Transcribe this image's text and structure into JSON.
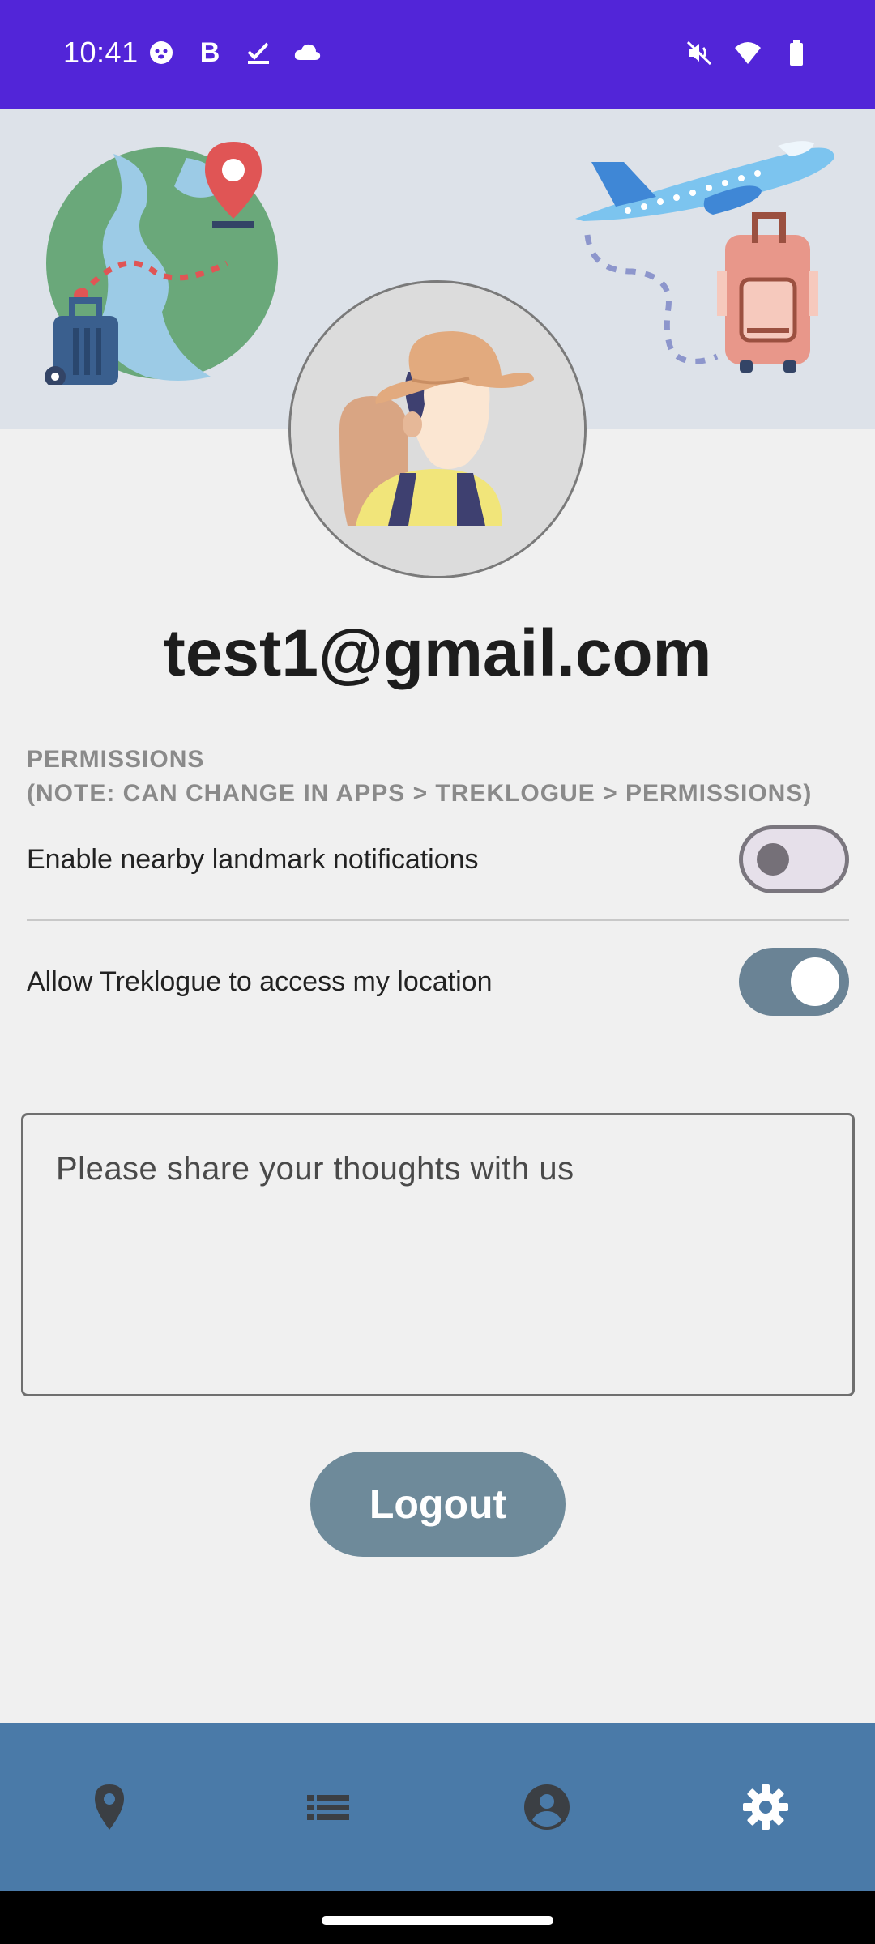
{
  "status_bar": {
    "time": "10:41",
    "left_icons": [
      "otter-icon",
      "bold-b-icon",
      "task-check-icon",
      "cloud-icon"
    ],
    "bold_letter": "B",
    "right_icons": [
      "mute-icon",
      "wifi-icon",
      "battery-icon"
    ],
    "background": "#5225d8"
  },
  "profile": {
    "email": "test1@gmail.com"
  },
  "permissions": {
    "title": "PERMISSIONS",
    "note": "(NOTE: CAN CHANGE IN APPS > TREKLOGUE > PERMISSIONS)",
    "items": [
      {
        "label": "Enable nearby landmark notifications",
        "enabled": false
      },
      {
        "label": "Allow Treklogue to access my location",
        "enabled": true
      }
    ]
  },
  "feedback": {
    "placeholder": "Please share your thoughts with us",
    "value": ""
  },
  "logout_label": "Logout",
  "bottom_nav": {
    "items": [
      {
        "name": "map",
        "icon": "location-pin-icon",
        "active": false
      },
      {
        "name": "list",
        "icon": "list-icon",
        "active": false
      },
      {
        "name": "profile",
        "icon": "account-circle-icon",
        "active": false
      },
      {
        "name": "settings",
        "icon": "gear-icon",
        "active": true
      }
    ],
    "background": "#4a7aa8"
  },
  "colors": {
    "accent": "#6e8a9a",
    "toggle_on": "#6a8395",
    "banner": "#dde2e9"
  }
}
